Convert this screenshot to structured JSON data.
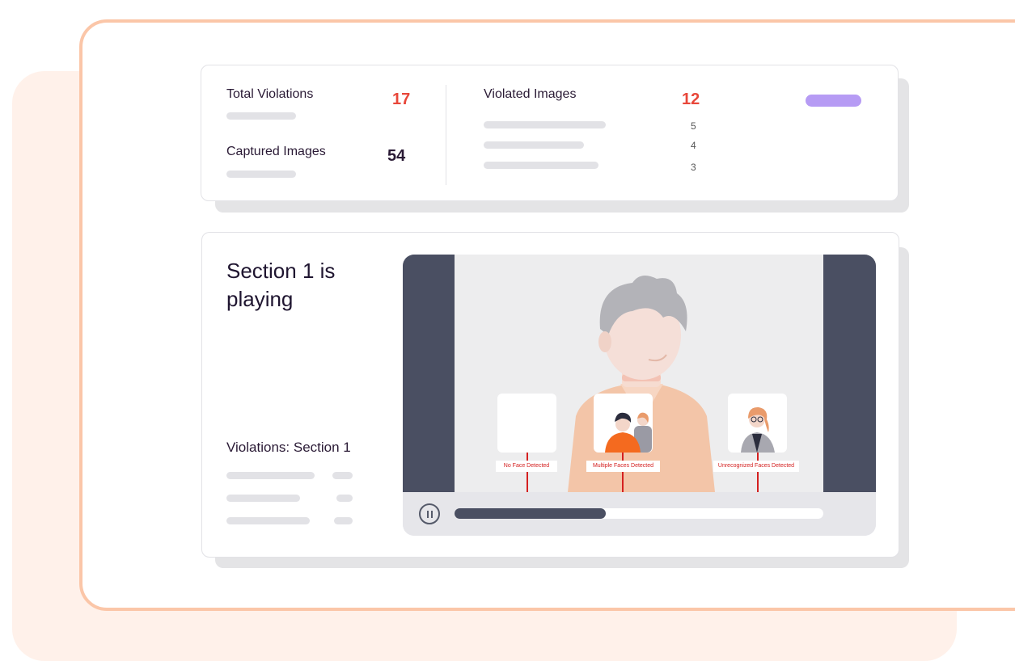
{
  "stats": {
    "total_violations_label": "Total Violations",
    "total_violations_value": "17",
    "captured_images_label": "Captured Images",
    "captured_images_value": "54",
    "violated_images_label": "Violated Images",
    "violated_images_value": "12",
    "breakdown": [
      "5",
      "4",
      "3"
    ]
  },
  "section": {
    "title_line1": "Section 1 is",
    "title_line2": "playing",
    "violations_label": "Violations: Section 1"
  },
  "player": {
    "progress": 0.41,
    "detections": [
      "No Face Detected",
      "Multiple Faces Detected",
      "Unrecognized Faces Detected"
    ]
  },
  "colors": {
    "accent_red": "#e8473a",
    "frame_peach": "#fbc6a8",
    "video_dark": "#4a4f62",
    "pill_purple": "#b69bf4"
  }
}
